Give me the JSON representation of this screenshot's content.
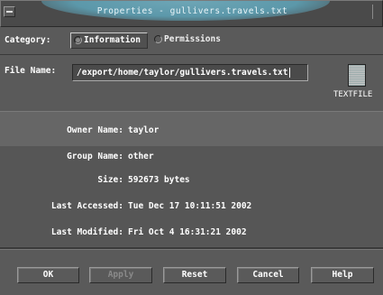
{
  "window": {
    "title": "Properties - gullivers.travels.txt"
  },
  "category": {
    "label": "Category:",
    "tabs": [
      {
        "label": "Information",
        "selected": true
      },
      {
        "label": "Permissions",
        "selected": false
      }
    ]
  },
  "file": {
    "label": "File Name:",
    "value": "/export/home/taylor/gullivers.travels.txt",
    "icon": "text-file-icon",
    "type_label": "TEXTFILE"
  },
  "info": {
    "rows": [
      {
        "label": "Owner Name:",
        "value": "taylor"
      },
      {
        "label": "Group Name:",
        "value": "other"
      },
      {
        "label": "Size:",
        "value": "592673 bytes"
      },
      {
        "label": "Last Accessed:",
        "value": "Tue Dec 17 10:11:51 2002"
      },
      {
        "label": "Last Modified:",
        "value": "Fri Oct  4 16:31:21 2002"
      }
    ]
  },
  "buttons": {
    "ok": "OK",
    "apply": "Apply",
    "reset": "Reset",
    "cancel": "Cancel",
    "help": "Help"
  }
}
